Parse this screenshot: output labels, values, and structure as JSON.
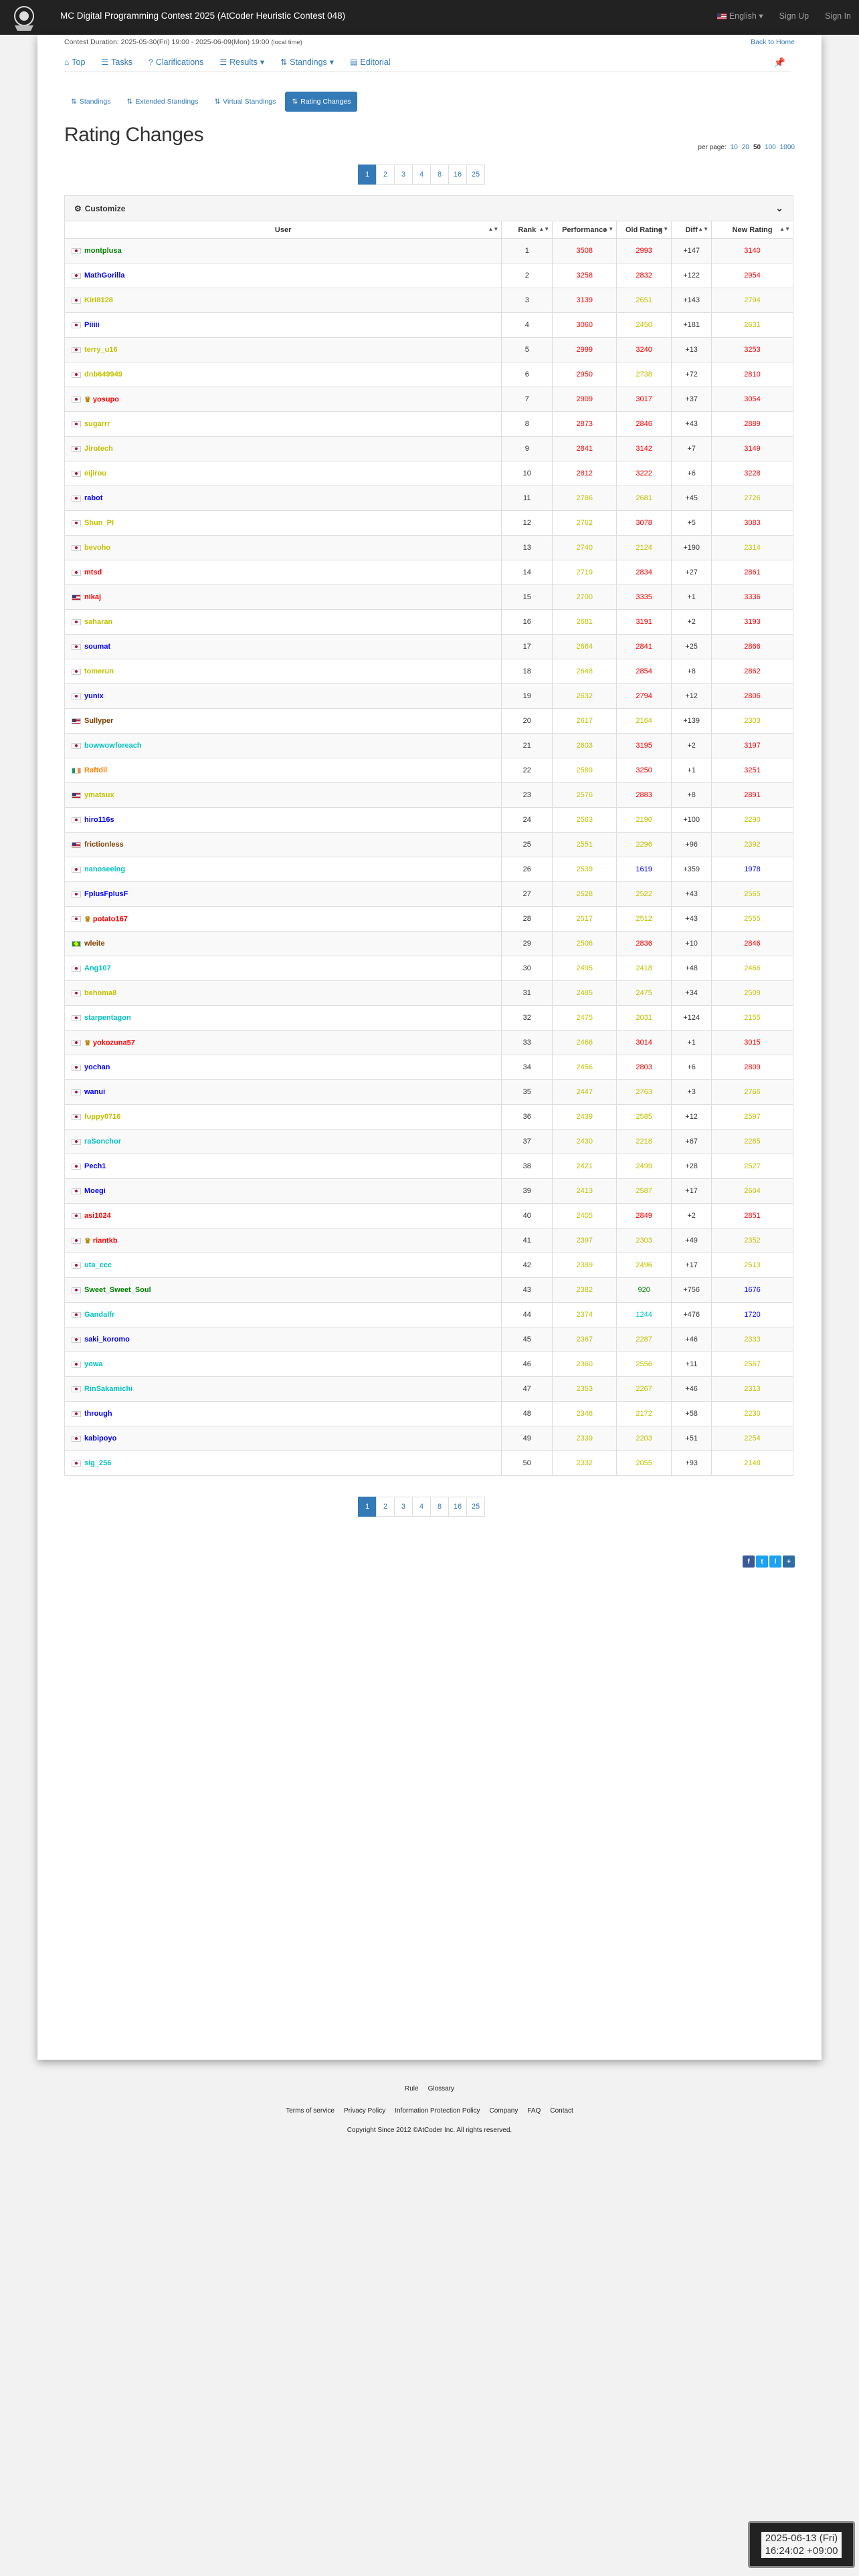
{
  "nav": {
    "title": "MC Digital Programming Contest 2025 (AtCoder Heuristic Contest 048)",
    "language": "English",
    "signup": "Sign Up",
    "signin": "Sign In"
  },
  "contest": {
    "duration_label": "Contest Duration:",
    "duration": "2025-05-30(Fri) 19:00 - 2025-06-09(Mon) 19:00",
    "local_time": "(local time)",
    "back_home": "Back to Home"
  },
  "tabs": [
    {
      "label": "Top",
      "icon": "home-icon"
    },
    {
      "label": "Tasks",
      "icon": "list-icon"
    },
    {
      "label": "Clarifications",
      "icon": "question-icon"
    },
    {
      "label": "Results",
      "icon": "list-icon"
    },
    {
      "label": "Standings",
      "icon": "sort-icon"
    },
    {
      "label": "Editorial",
      "icon": "book-icon"
    }
  ],
  "subtabs": [
    {
      "label": "Standings"
    },
    {
      "label": "Extended Standings"
    },
    {
      "label": "Virtual Standings"
    },
    {
      "label": "Rating Changes"
    }
  ],
  "page_title": "Rating Changes",
  "per_page": {
    "label": "per page:",
    "options": [
      "10",
      "20",
      "50",
      "100",
      "1000"
    ],
    "selected": "50"
  },
  "pagination": [
    "1",
    "2",
    "3",
    "4",
    "8",
    "16",
    "25"
  ],
  "customize_label": "Customize",
  "columns": [
    "User",
    "Rank",
    "Performance",
    "Old Rating",
    "Diff",
    "New Rating"
  ],
  "colors": {
    "red": "#FF0000",
    "orange": "#FF8000",
    "yellow": "#C0C000",
    "blue": "#0000FF",
    "cyan": "#00C0C0",
    "green": "#008000",
    "brown": "#804000",
    "gray": "#808080"
  },
  "rows": [
    {
      "flag": "jp",
      "user": "montplusa",
      "uc": "green",
      "rank": "1",
      "perf": "3508",
      "pc": "red",
      "old": "2993",
      "oc": "red",
      "diff": "+147",
      "new": "3140",
      "nc": "red"
    },
    {
      "flag": "jp",
      "user": "MathGorilla",
      "uc": "blue",
      "rank": "2",
      "perf": "3258",
      "pc": "red",
      "old": "2832",
      "oc": "red",
      "diff": "+122",
      "new": "2954",
      "nc": "red"
    },
    {
      "flag": "jp",
      "user": "Kiri8128",
      "uc": "yellow",
      "rank": "3",
      "perf": "3139",
      "pc": "red",
      "old": "2651",
      "oc": "yellow",
      "diff": "+143",
      "new": "2794",
      "nc": "yellow"
    },
    {
      "flag": "jp",
      "user": "Piiiii",
      "uc": "blue",
      "rank": "4",
      "perf": "3060",
      "pc": "red",
      "old": "2450",
      "oc": "yellow",
      "diff": "+181",
      "new": "2631",
      "nc": "yellow"
    },
    {
      "flag": "jp",
      "user": "terry_u16",
      "uc": "yellow",
      "rank": "5",
      "perf": "2999",
      "pc": "red",
      "old": "3240",
      "oc": "red",
      "diff": "+13",
      "new": "3253",
      "nc": "red"
    },
    {
      "flag": "jp",
      "user": "dnb649949",
      "uc": "yellow",
      "rank": "6",
      "perf": "2950",
      "pc": "red",
      "old": "2738",
      "oc": "yellow",
      "diff": "+72",
      "new": "2810",
      "nc": "red"
    },
    {
      "flag": "jp",
      "user": "yosupo",
      "uc": "red",
      "crown": true,
      "rank": "7",
      "perf": "2909",
      "pc": "red",
      "old": "3017",
      "oc": "red",
      "diff": "+37",
      "new": "3054",
      "nc": "red"
    },
    {
      "flag": "jp",
      "user": "sugarrr",
      "uc": "yellow",
      "rank": "8",
      "perf": "2873",
      "pc": "red",
      "old": "2846",
      "oc": "red",
      "diff": "+43",
      "new": "2889",
      "nc": "red"
    },
    {
      "flag": "jp",
      "user": "Jirotech",
      "uc": "yellow",
      "rank": "9",
      "perf": "2841",
      "pc": "red",
      "old": "3142",
      "oc": "red",
      "diff": "+7",
      "new": "3149",
      "nc": "red"
    },
    {
      "flag": "jp",
      "user": "eijirou",
      "uc": "yellow",
      "rank": "10",
      "perf": "2812",
      "pc": "red",
      "old": "3222",
      "oc": "red",
      "diff": "+6",
      "new": "3228",
      "nc": "red"
    },
    {
      "flag": "jp",
      "user": "rabot",
      "uc": "blue",
      "rank": "11",
      "perf": "2786",
      "pc": "yellow",
      "old": "2681",
      "oc": "yellow",
      "diff": "+45",
      "new": "2726",
      "nc": "yellow"
    },
    {
      "flag": "jp",
      "user": "Shun_PI",
      "uc": "yellow",
      "rank": "12",
      "perf": "2762",
      "pc": "yellow",
      "old": "3078",
      "oc": "red",
      "diff": "+5",
      "new": "3083",
      "nc": "red"
    },
    {
      "flag": "jp",
      "user": "bevoho",
      "uc": "yellow",
      "rank": "13",
      "perf": "2740",
      "pc": "yellow",
      "old": "2124",
      "oc": "yellow",
      "diff": "+190",
      "new": "2314",
      "nc": "yellow"
    },
    {
      "flag": "jp",
      "user": "mtsd",
      "uc": "red",
      "rank": "14",
      "perf": "2719",
      "pc": "yellow",
      "old": "2834",
      "oc": "red",
      "diff": "+27",
      "new": "2861",
      "nc": "red"
    },
    {
      "flag": "us",
      "user": "nikaj",
      "uc": "red",
      "rank": "15",
      "perf": "2700",
      "pc": "yellow",
      "old": "3335",
      "oc": "red",
      "diff": "+1",
      "new": "3336",
      "nc": "red"
    },
    {
      "flag": "jp",
      "user": "saharan",
      "uc": "yellow",
      "rank": "16",
      "perf": "2681",
      "pc": "yellow",
      "old": "3191",
      "oc": "red",
      "diff": "+2",
      "new": "3193",
      "nc": "red"
    },
    {
      "flag": "jp",
      "user": "soumat",
      "uc": "blue",
      "rank": "17",
      "perf": "2664",
      "pc": "yellow",
      "old": "2841",
      "oc": "red",
      "diff": "+25",
      "new": "2866",
      "nc": "red"
    },
    {
      "flag": "jp",
      "user": "tomerun",
      "uc": "yellow",
      "rank": "18",
      "perf": "2648",
      "pc": "yellow",
      "old": "2854",
      "oc": "red",
      "diff": "+8",
      "new": "2862",
      "nc": "red"
    },
    {
      "flag": "jp",
      "user": "yunix",
      "uc": "blue",
      "rank": "19",
      "perf": "2632",
      "pc": "yellow",
      "old": "2794",
      "oc": "red",
      "diff": "+12",
      "new": "2806",
      "nc": "red"
    },
    {
      "flag": "us",
      "user": "Sullyper",
      "uc": "brown",
      "rank": "20",
      "perf": "2617",
      "pc": "yellow",
      "old": "2164",
      "oc": "yellow",
      "diff": "+139",
      "new": "2303",
      "nc": "yellow"
    },
    {
      "flag": "jp",
      "user": "bowwowforeach",
      "uc": "cyan",
      "rank": "21",
      "perf": "2603",
      "pc": "yellow",
      "old": "3195",
      "oc": "red",
      "diff": "+2",
      "new": "3197",
      "nc": "red"
    },
    {
      "flag": "ie",
      "user": "Raftdil",
      "uc": "orange",
      "rank": "22",
      "perf": "2589",
      "pc": "yellow",
      "old": "3250",
      "oc": "red",
      "diff": "+1",
      "new": "3251",
      "nc": "red"
    },
    {
      "flag": "us",
      "user": "ymatsux",
      "uc": "yellow",
      "rank": "23",
      "perf": "2576",
      "pc": "yellow",
      "old": "2883",
      "oc": "red",
      "diff": "+8",
      "new": "2891",
      "nc": "red"
    },
    {
      "flag": "jp",
      "user": "hiro116s",
      "uc": "blue",
      "rank": "24",
      "perf": "2563",
      "pc": "yellow",
      "old": "2190",
      "oc": "yellow",
      "diff": "+100",
      "new": "2290",
      "nc": "yellow"
    },
    {
      "flag": "us",
      "user": "frictionless",
      "uc": "brown",
      "rank": "25",
      "perf": "2551",
      "pc": "yellow",
      "old": "2296",
      "oc": "yellow",
      "diff": "+96",
      "new": "2392",
      "nc": "yellow"
    },
    {
      "flag": "jp",
      "user": "nanoseeing",
      "uc": "cyan",
      "rank": "26",
      "perf": "2539",
      "pc": "yellow",
      "old": "1619",
      "oc": "blue",
      "diff": "+359",
      "new": "1978",
      "nc": "blue"
    },
    {
      "flag": "jp",
      "user": "FplusFplusF",
      "uc": "blue",
      "rank": "27",
      "perf": "2528",
      "pc": "yellow",
      "old": "2522",
      "oc": "yellow",
      "diff": "+43",
      "new": "2565",
      "nc": "yellow"
    },
    {
      "flag": "jp",
      "user": "potato167",
      "uc": "red",
      "crown": true,
      "rank": "28",
      "perf": "2517",
      "pc": "yellow",
      "old": "2512",
      "oc": "yellow",
      "diff": "+43",
      "new": "2555",
      "nc": "yellow"
    },
    {
      "flag": "br",
      "user": "wleite",
      "uc": "brown",
      "rank": "29",
      "perf": "2506",
      "pc": "yellow",
      "old": "2836",
      "oc": "red",
      "diff": "+10",
      "new": "2846",
      "nc": "red"
    },
    {
      "flag": "jp",
      "user": "Ang107",
      "uc": "cyan",
      "rank": "30",
      "perf": "2495",
      "pc": "yellow",
      "old": "2418",
      "oc": "yellow",
      "diff": "+48",
      "new": "2466",
      "nc": "yellow"
    },
    {
      "flag": "jp",
      "user": "behoma8",
      "uc": "yellow",
      "rank": "31",
      "perf": "2485",
      "pc": "yellow",
      "old": "2475",
      "oc": "yellow",
      "diff": "+34",
      "new": "2509",
      "nc": "yellow"
    },
    {
      "flag": "jp",
      "user": "starpentagon",
      "uc": "cyan",
      "rank": "32",
      "perf": "2475",
      "pc": "yellow",
      "old": "2031",
      "oc": "yellow",
      "diff": "+124",
      "new": "2155",
      "nc": "yellow"
    },
    {
      "flag": "jp",
      "user": "yokozuna57",
      "uc": "red",
      "crown": true,
      "rank": "33",
      "perf": "2466",
      "pc": "yellow",
      "old": "3014",
      "oc": "red",
      "diff": "+1",
      "new": "3015",
      "nc": "red"
    },
    {
      "flag": "jp",
      "user": "yochan",
      "uc": "blue",
      "rank": "34",
      "perf": "2456",
      "pc": "yellow",
      "old": "2803",
      "oc": "red",
      "diff": "+6",
      "new": "2809",
      "nc": "red"
    },
    {
      "flag": "jp",
      "user": "wanui",
      "uc": "blue",
      "rank": "35",
      "perf": "2447",
      "pc": "yellow",
      "old": "2763",
      "oc": "yellow",
      "diff": "+3",
      "new": "2766",
      "nc": "yellow"
    },
    {
      "flag": "jp",
      "user": "fuppy0716",
      "uc": "yellow",
      "rank": "36",
      "perf": "2439",
      "pc": "yellow",
      "old": "2585",
      "oc": "yellow",
      "diff": "+12",
      "new": "2597",
      "nc": "yellow"
    },
    {
      "flag": "jp",
      "user": "raSonchor",
      "uc": "cyan",
      "rank": "37",
      "perf": "2430",
      "pc": "yellow",
      "old": "2218",
      "oc": "yellow",
      "diff": "+67",
      "new": "2285",
      "nc": "yellow"
    },
    {
      "flag": "jp",
      "user": "Pech1",
      "uc": "blue",
      "rank": "38",
      "perf": "2421",
      "pc": "yellow",
      "old": "2499",
      "oc": "yellow",
      "diff": "+28",
      "new": "2527",
      "nc": "yellow"
    },
    {
      "flag": "jp",
      "user": "Moegi",
      "uc": "blue",
      "rank": "39",
      "perf": "2413",
      "pc": "yellow",
      "old": "2587",
      "oc": "yellow",
      "diff": "+17",
      "new": "2604",
      "nc": "yellow"
    },
    {
      "flag": "jp",
      "user": "asi1024",
      "uc": "red",
      "rank": "40",
      "perf": "2405",
      "pc": "yellow",
      "old": "2849",
      "oc": "red",
      "diff": "+2",
      "new": "2851",
      "nc": "red"
    },
    {
      "flag": "jp",
      "user": "riantkb",
      "uc": "red",
      "crown": true,
      "rank": "41",
      "perf": "2397",
      "pc": "yellow",
      "old": "2303",
      "oc": "yellow",
      "diff": "+49",
      "new": "2352",
      "nc": "yellow"
    },
    {
      "flag": "jp",
      "user": "uta_ccc",
      "uc": "cyan",
      "rank": "42",
      "perf": "2389",
      "pc": "yellow",
      "old": "2496",
      "oc": "yellow",
      "diff": "+17",
      "new": "2513",
      "nc": "yellow"
    },
    {
      "flag": "jp",
      "user": "Sweet_Sweet_Soul",
      "uc": "green",
      "rank": "43",
      "perf": "2382",
      "pc": "yellow",
      "old": "920",
      "oc": "green",
      "diff": "+756",
      "new": "1676",
      "nc": "blue"
    },
    {
      "flag": "jp",
      "user": "Gandalfr",
      "uc": "cyan",
      "rank": "44",
      "perf": "2374",
      "pc": "yellow",
      "old": "1244",
      "oc": "cyan",
      "diff": "+476",
      "new": "1720",
      "nc": "blue"
    },
    {
      "flag": "jp",
      "user": "saki_koromo",
      "uc": "blue",
      "rank": "45",
      "perf": "2367",
      "pc": "yellow",
      "old": "2287",
      "oc": "yellow",
      "diff": "+46",
      "new": "2333",
      "nc": "yellow"
    },
    {
      "flag": "jp",
      "user": "yowa",
      "uc": "cyan",
      "rank": "46",
      "perf": "2360",
      "pc": "yellow",
      "old": "2556",
      "oc": "yellow",
      "diff": "+11",
      "new": "2567",
      "nc": "yellow"
    },
    {
      "flag": "jp",
      "user": "RinSakamichi",
      "uc": "cyan",
      "rank": "47",
      "perf": "2353",
      "pc": "yellow",
      "old": "2267",
      "oc": "yellow",
      "diff": "+46",
      "new": "2313",
      "nc": "yellow"
    },
    {
      "flag": "jp",
      "user": "through",
      "uc": "blue",
      "rank": "48",
      "perf": "2346",
      "pc": "yellow",
      "old": "2172",
      "oc": "yellow",
      "diff": "+58",
      "new": "2230",
      "nc": "yellow"
    },
    {
      "flag": "jp",
      "user": "kabipoyo",
      "uc": "blue",
      "rank": "49",
      "perf": "2339",
      "pc": "yellow",
      "old": "2203",
      "oc": "yellow",
      "diff": "+51",
      "new": "2254",
      "nc": "yellow"
    },
    {
      "flag": "jp",
      "user": "sig_256",
      "uc": "cyan",
      "rank": "50",
      "perf": "2332",
      "pc": "yellow",
      "old": "2055",
      "oc": "yellow",
      "diff": "+93",
      "new": "2148",
      "nc": "yellow"
    }
  ],
  "share": [
    "f",
    "t",
    "l",
    "+"
  ],
  "footer": {
    "row1": [
      "Rule",
      "Glossary"
    ],
    "row2": [
      "Terms of service",
      "Privacy Policy",
      "Information Protection Policy",
      "Company",
      "FAQ",
      "Contact"
    ],
    "copyright": "Copyright Since 2012 ©AtCoder Inc. All rights reserved."
  },
  "clock": {
    "date": "2025-06-13 (Fri)",
    "time": "16:24:02 +09:00"
  }
}
